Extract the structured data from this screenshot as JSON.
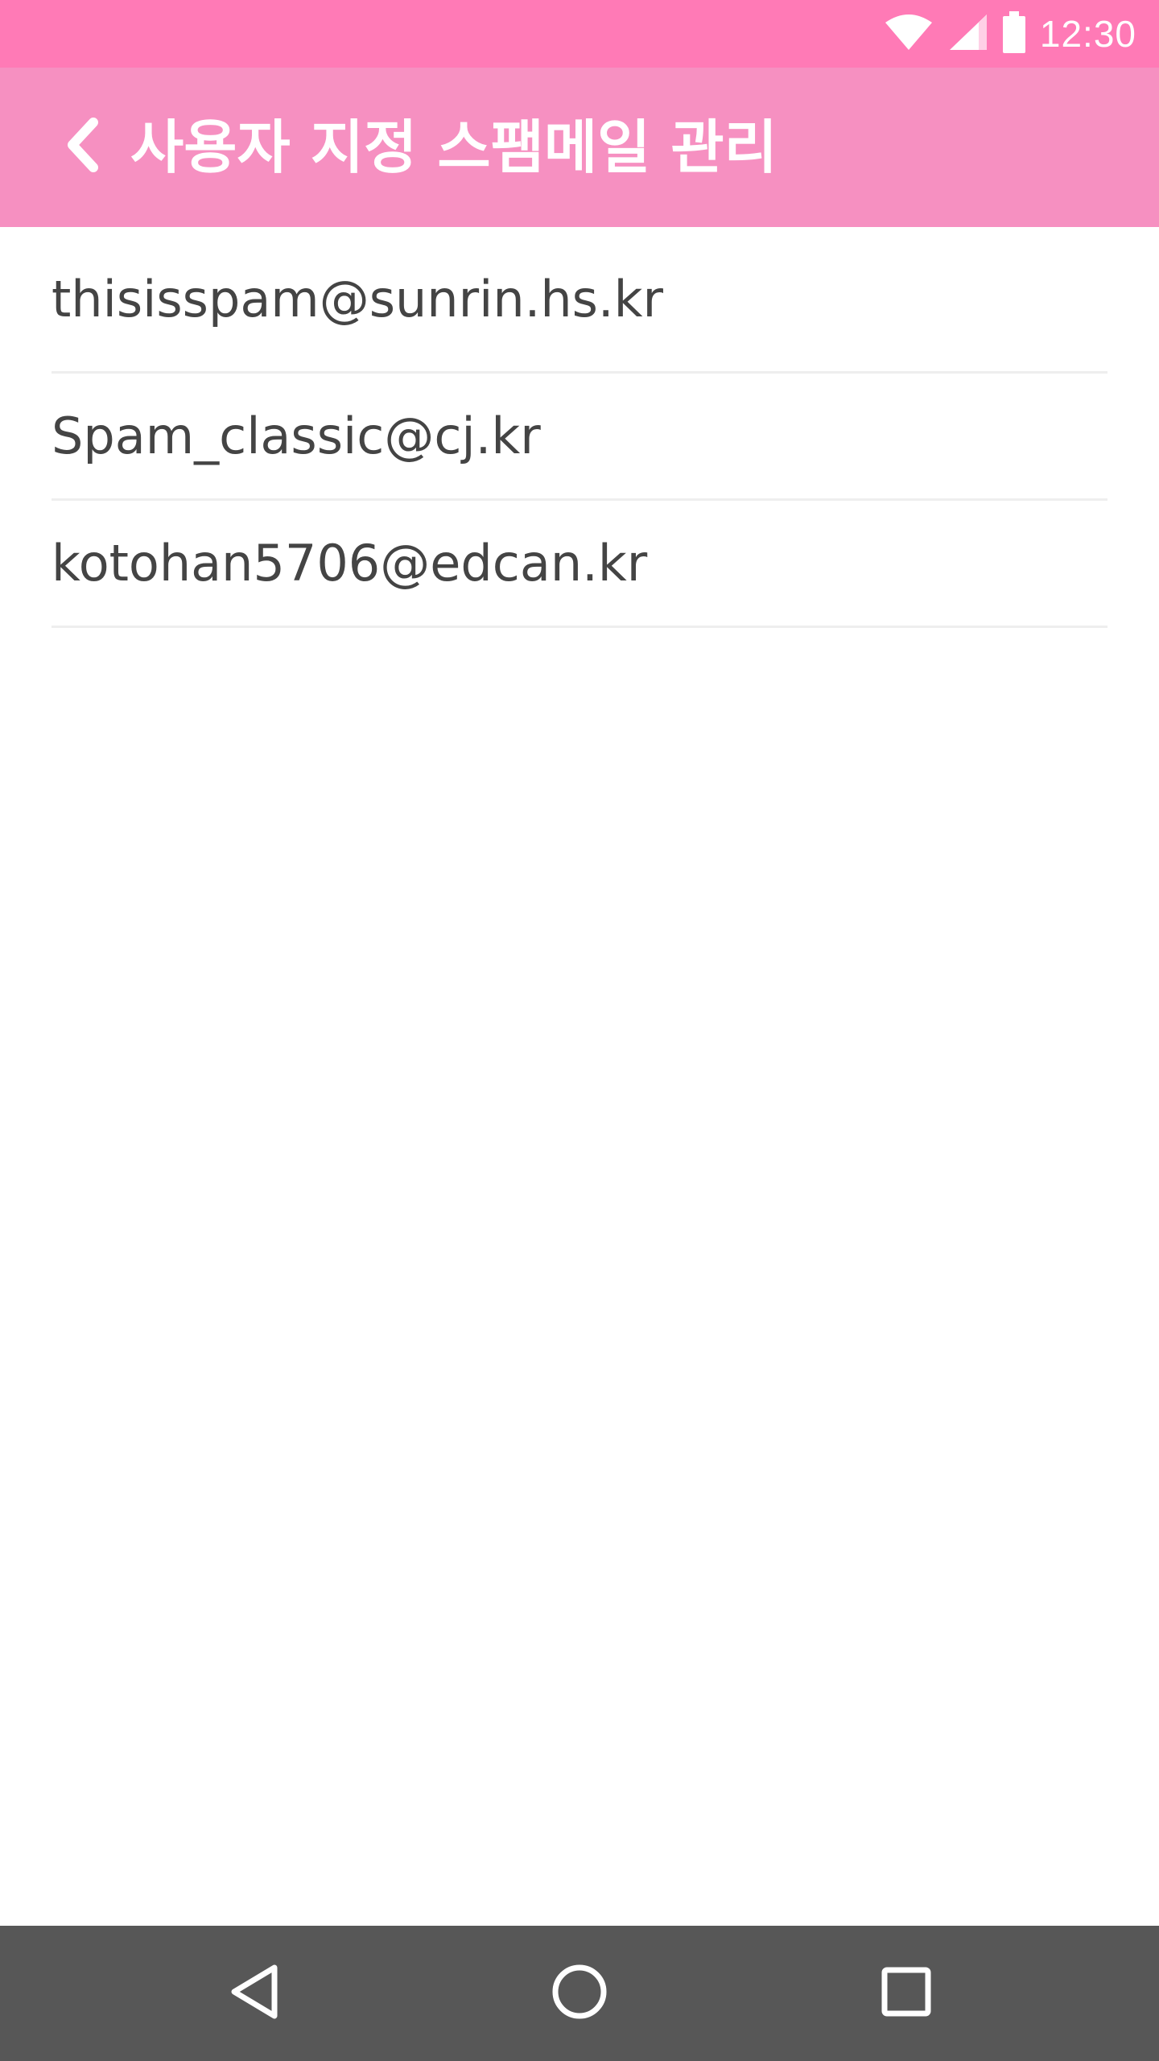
{
  "status_bar": {
    "time": "12:30",
    "icons": [
      "wifi-icon",
      "signal-icon",
      "battery-icon"
    ]
  },
  "app_bar": {
    "back_icon": "chevron-left-icon",
    "title": "사용자 지정 스팸메일 관리"
  },
  "spam_list": {
    "items": [
      {
        "email": "thisisspam@sunrin.hs.kr"
      },
      {
        "email": "Spam_classic@cj.kr"
      },
      {
        "email": "kotohan5706@edcan.kr"
      }
    ]
  },
  "nav_bar": {
    "icons": [
      "nav-back-icon",
      "nav-home-icon",
      "nav-recents-icon"
    ]
  },
  "colors": {
    "status_bar": "#ff7ab6",
    "app_bar": "#f690c1",
    "nav_bar": "#575757",
    "list_text": "#444444",
    "divider": "#eeeeee"
  }
}
